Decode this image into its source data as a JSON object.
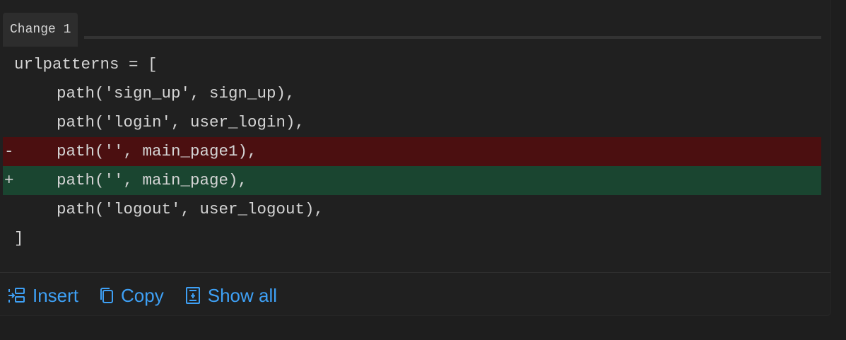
{
  "change_tab": {
    "label": "Change 1"
  },
  "code_lines": [
    {
      "marker": "",
      "text": "urlpatterns = [",
      "kind": "context"
    },
    {
      "marker": "",
      "text": "path('sign_up', sign_up),",
      "kind": "context"
    },
    {
      "marker": "",
      "text": "path('login', user_login),",
      "kind": "context"
    },
    {
      "marker": "-",
      "text": "path('', main_page1),",
      "kind": "removed"
    },
    {
      "marker": "+",
      "text": "path('', main_page),",
      "kind": "added"
    },
    {
      "marker": "",
      "text": "path('logout', user_logout),",
      "kind": "context"
    },
    {
      "marker": "",
      "text": "]",
      "kind": "context"
    }
  ],
  "actions": {
    "insert": {
      "label": "Insert",
      "icon": "insert-icon"
    },
    "copy": {
      "label": "Copy",
      "icon": "copy-icon"
    },
    "show_all": {
      "label": "Show all",
      "icon": "show-all-icon"
    }
  },
  "colors": {
    "removed_bg": "#4b0f10",
    "added_bg": "#1a4530",
    "link": "#3ea0f5"
  }
}
